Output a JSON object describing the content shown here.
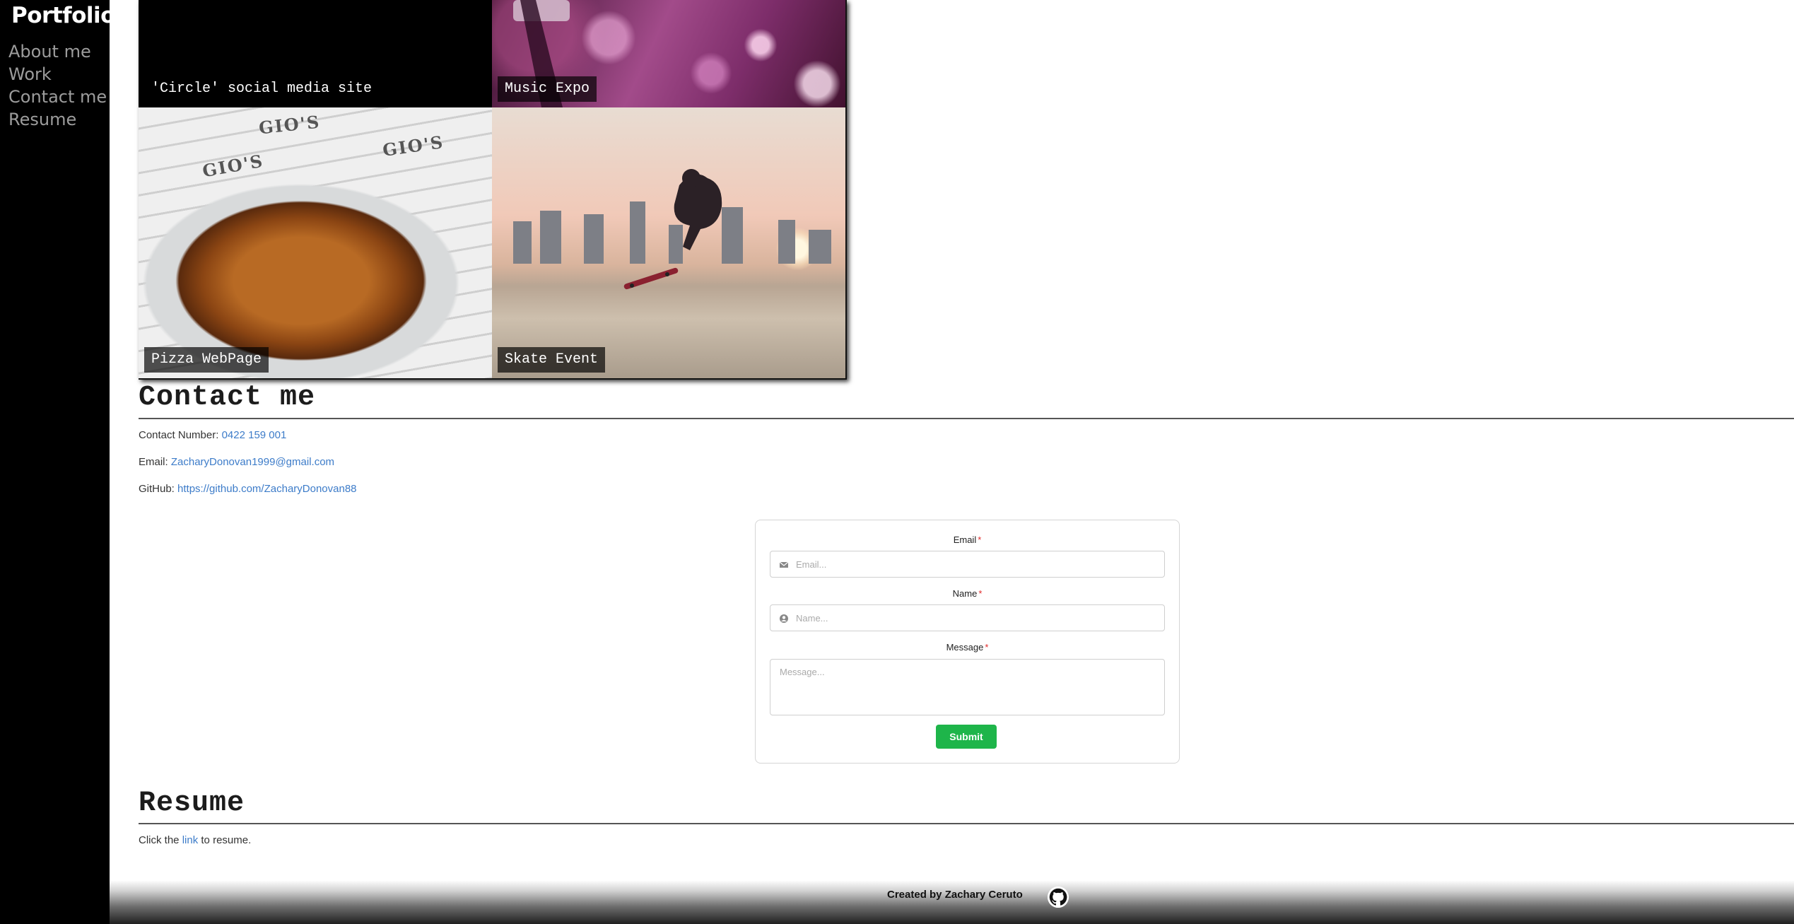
{
  "sidebar": {
    "brand": "Portfolio",
    "items": [
      {
        "label": "About me"
      },
      {
        "label": "Work"
      },
      {
        "label": "Contact me"
      },
      {
        "label": "Resume"
      }
    ]
  },
  "work": {
    "tiles": [
      {
        "caption": "'Circle' social media site"
      },
      {
        "caption": "Music Expo"
      },
      {
        "caption": "Pizza WebPage",
        "sign_text": "GIO'S"
      },
      {
        "caption": "Skate Event"
      }
    ]
  },
  "contact": {
    "title": "Contact me",
    "phone_label": "Contact Number:",
    "phone_value": "0422 159 001",
    "email_label": "Email:",
    "email_value": "ZacharyDonovan1999@gmail.com",
    "github_label": "GitHub:",
    "github_value": "https://github.com/ZacharyDonovan88"
  },
  "form": {
    "email_label": "Email",
    "email_placeholder": "Email...",
    "name_label": "Name",
    "name_placeholder": "Name...",
    "message_label": "Message",
    "message_placeholder": "Message...",
    "required_mark": "*",
    "submit_label": "Submit",
    "submit_color": "#1eb54a"
  },
  "resume": {
    "title": "Resume",
    "text_before": "Click the",
    "link_text": "link",
    "text_after": "to resume."
  },
  "footer": {
    "credit": "Created by Zachary Ceruto",
    "icon": "github-icon"
  }
}
